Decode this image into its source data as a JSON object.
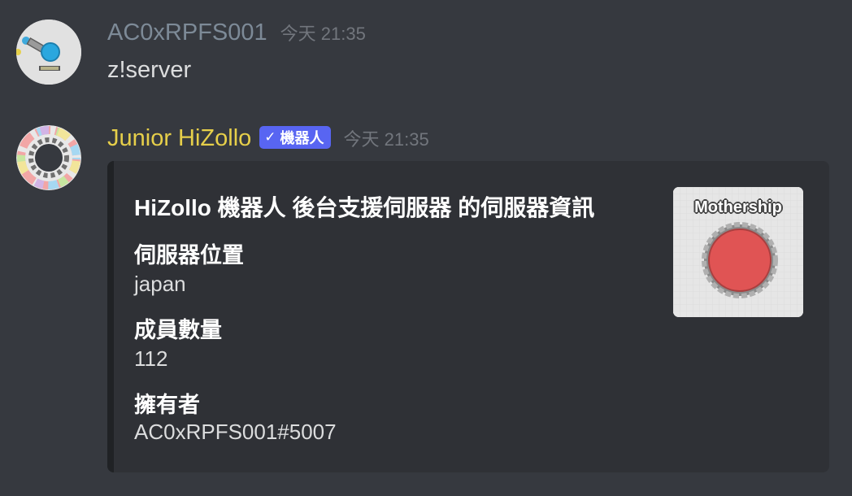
{
  "messages": [
    {
      "username": "AC0xRPFS001",
      "username_color": "#7d8a97",
      "timestamp": "今天 21:35",
      "content": "z!server",
      "avatar_icon": "tank-icon"
    },
    {
      "username": "Junior HiZollo",
      "username_color": "#e6cf4a",
      "bot_tag": {
        "check": "✓",
        "label": "機器人"
      },
      "timestamp": "今天 21:35",
      "avatar_icon": "ring-avatar-icon",
      "embed": {
        "title": "HiZollo 機器人 後台支援伺服器 的伺服器資訊",
        "fields": [
          {
            "name": "伺服器位置",
            "value": "japan"
          },
          {
            "name": "成員數量",
            "value": "112"
          },
          {
            "name": "擁有者",
            "value": "AC0xRPFS001#5007"
          }
        ],
        "thumbnail": {
          "label": "Mothership",
          "icon": "mothership-icon",
          "body_color": "#e05454"
        }
      }
    }
  ]
}
